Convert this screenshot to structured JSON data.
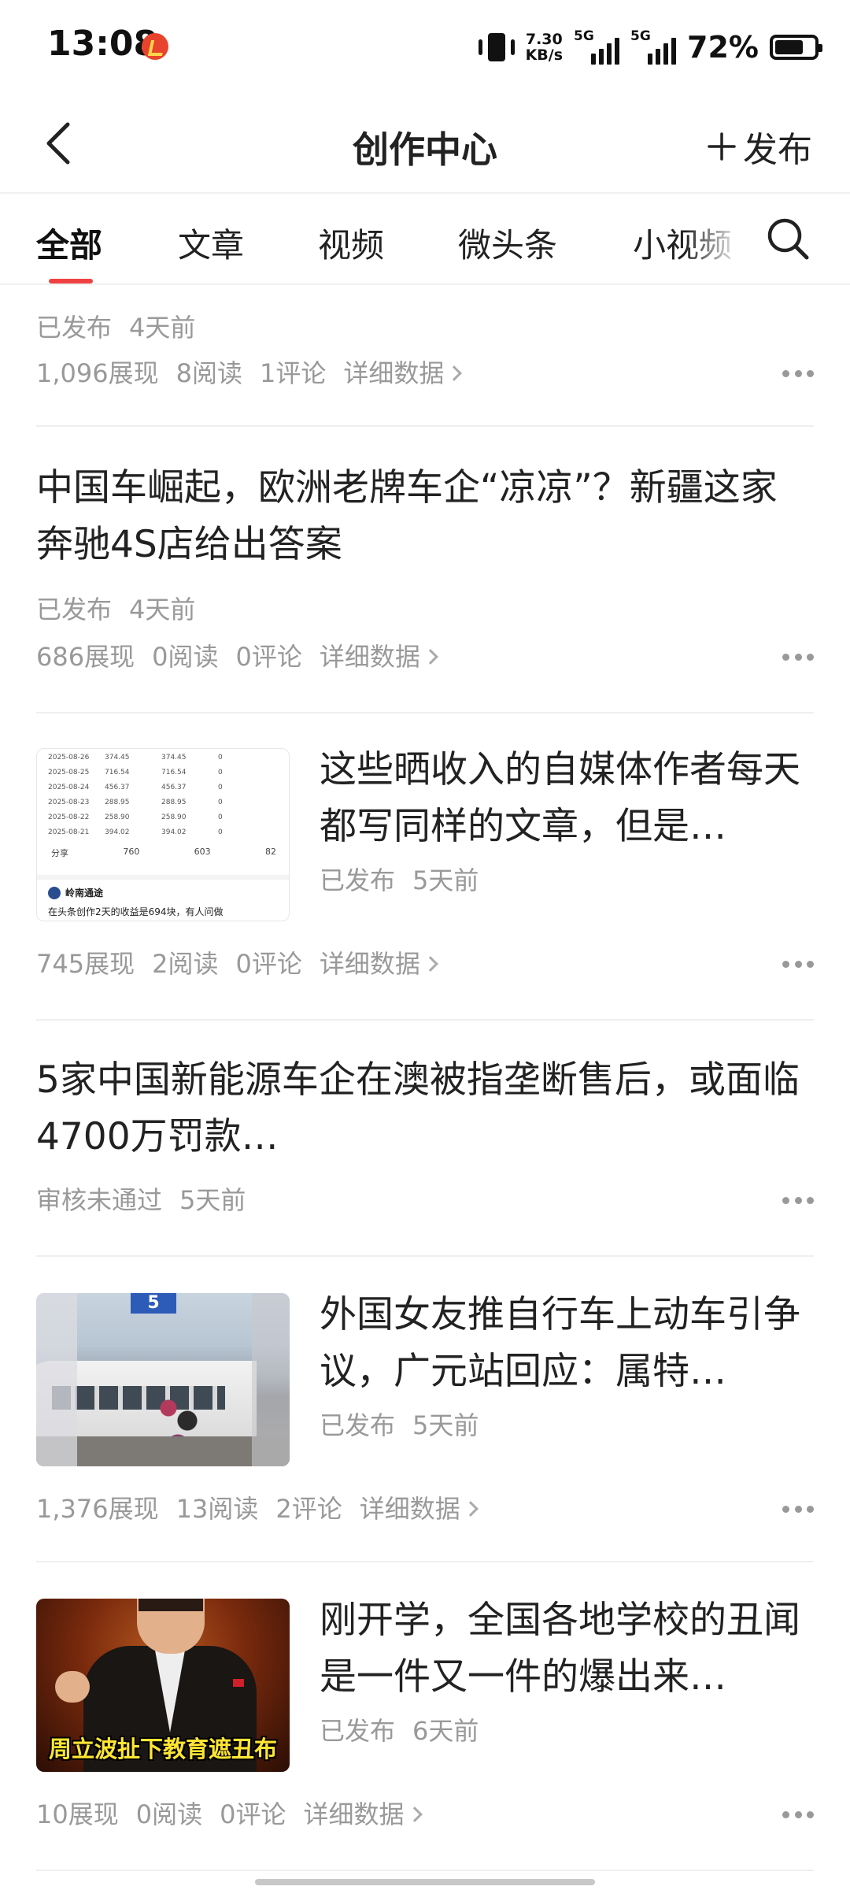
{
  "status_bar": {
    "time": "13:08",
    "net_speed_value": "7.30",
    "net_speed_unit": "KB/s",
    "sim1": "5G",
    "sim2": "5G",
    "battery_percent": "72%",
    "battery_level": 0.72
  },
  "nav": {
    "title": "创作中心",
    "publish_label": "发布"
  },
  "tabs": [
    "全部",
    "文章",
    "视频",
    "微头条",
    "小视频"
  ],
  "active_tab": "全部",
  "feed": [
    {
      "status": "已发布",
      "time": "4天前",
      "views": "1,096展现",
      "reads": "8阅读",
      "comments": "1评论",
      "detail": "详细数据"
    },
    {
      "title": "中国车崛起，欧洲老牌车企“凉凉”？新疆这家奔驰4S店给出答案",
      "status": "已发布",
      "time": "4天前",
      "views": "686展现",
      "reads": "0阅读",
      "comments": "0评论",
      "detail": "详细数据"
    },
    {
      "title": "这些晒收入的自媒体作者每天都写同样的文章，但是…",
      "status": "已发布",
      "time": "5天前",
      "views": "745展现",
      "reads": "2阅读",
      "comments": "0评论",
      "detail": "详细数据",
      "thumb": {
        "rows": [
          [
            "2025-08-26",
            "374.45",
            "374.45",
            "0"
          ],
          [
            "2025-08-25",
            "716.54",
            "716.54",
            "0"
          ],
          [
            "2025-08-24",
            "456.37",
            "456.37",
            "0"
          ],
          [
            "2025-08-23",
            "288.95",
            "288.95",
            "0"
          ],
          [
            "2025-08-22",
            "258.90",
            "258.90",
            "0"
          ],
          [
            "2025-08-21",
            "394.02",
            "394.02",
            "0"
          ]
        ],
        "share": "分享",
        "comments": "760",
        "likes": "603",
        "favs": "82",
        "author": "岭南通途",
        "caption": "在头条创作2天的收益是694块，有人问做"
      }
    },
    {
      "title": "5家中国新能源车企在澳被指垄断售后，或面临4700万罚款…",
      "status": "审核未通过",
      "time": "5天前"
    },
    {
      "title": "外国女友推自行车上动车引争议，广元站回应：属特…",
      "status": "已发布",
      "time": "5天前",
      "views": "1,376展现",
      "reads": "13阅读",
      "comments": "2评论",
      "detail": "详细数据",
      "thumb": {
        "sign": "5"
      }
    },
    {
      "title": "刚开学，全国各地学校的丑闻是一件又一件的爆出来…",
      "status": "已发布",
      "time": "6天前",
      "views": "10展现",
      "reads": "0阅读",
      "comments": "0评论",
      "detail": "详细数据",
      "thumb": {
        "caption": "周立波扯下教育遮丑布"
      }
    }
  ],
  "colors": {
    "accent": "#f04142",
    "meta_text": "#999999",
    "title_text": "#222222"
  }
}
